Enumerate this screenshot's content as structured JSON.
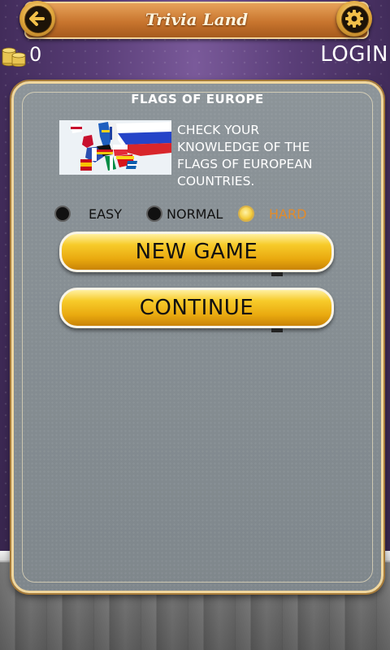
{
  "app": {
    "title": "Trivia Land"
  },
  "header": {
    "coins": "0",
    "login_label": "LOGIN"
  },
  "quiz": {
    "title": "FLAGS OF EUROPE",
    "description_lines": [
      "CHECK YOUR",
      "KNOWLEDGE OF THE",
      "FLAGS OF EUROPEAN",
      "COUNTRIES."
    ]
  },
  "difficulty": {
    "options": [
      {
        "label": "EASY",
        "selected": false
      },
      {
        "label": "NORMAL",
        "selected": false
      },
      {
        "label": "HARD",
        "selected": true
      }
    ]
  },
  "buttons": {
    "new_game": "NEW GAME",
    "continue": "CONTINUE"
  },
  "colors": {
    "accent": "#e9a90f",
    "selected_text": "#e38b2a",
    "header": "#c8752e"
  },
  "icons": {
    "back": "back-arrow-icon",
    "settings": "gear-icon",
    "coins": "coin-stack-icon"
  }
}
